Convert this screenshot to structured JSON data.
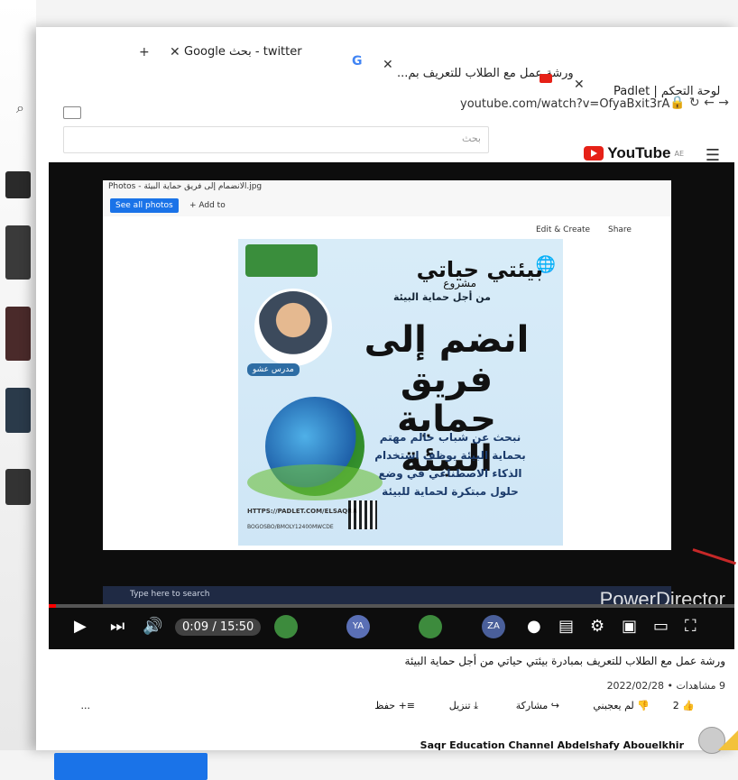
{
  "tabs": [
    {
      "label": "لوحة التحكم | Padlet",
      "icon": "padlet-icon"
    },
    {
      "label": "ورشة عمل مع الطلاب للتعريف بم...",
      "icon": "youtube-icon"
    },
    {
      "label": "twitter - بحث Google",
      "icon": "google-icon"
    }
  ],
  "new_tab_symbol": "+",
  "address": {
    "url": "youtube.com/watch?v=OfyaBxit3rA"
  },
  "search": {
    "placeholder": "بحث"
  },
  "youtube": {
    "brand": "YouTube",
    "region": "AE"
  },
  "photos_app": {
    "title": "Photos - الانضمام إلى فريق حماية البيئة.jpg",
    "see_all": "See all photos",
    "add_to": "+ Add to",
    "edit_create": "Edit & Create",
    "share": "Share"
  },
  "poster": {
    "brand_title": "بيئتي حياتي",
    "project_word": "مشروع",
    "subtitle": "من أجل حماية البيئة",
    "headline": "انضم إلى فريق حماية البيئة",
    "body": "نبحث عن شباب حالم مهتم بحماية البيئة يوظف استخدام الذكاء الاصطناعي في وضع حلول مبتكرة لحماية للبيئة",
    "url_line1": "HTTPS://PADLET.COM/ELSAQRA",
    "url_line2": "BOGOSBO/BMOLY12400MWCDE",
    "teacher_label": "مدرس عشو"
  },
  "taskbar": {
    "search_placeholder": "Type here to search"
  },
  "watermark": "PowerDirector",
  "player": {
    "time": "0:09 / 15:50",
    "progress": 0.01
  },
  "participants": [
    {
      "initials": "",
      "color": "#3d8b3d"
    },
    {
      "initials": "YA",
      "color": "#5a6fb5"
    },
    {
      "initials": "",
      "color": "#3d8b3d"
    },
    {
      "initials": "ZA",
      "color": "#4a5f9a"
    }
  ],
  "video": {
    "title": "ورشة عمل مع الطلاب للتعريف بمبادرة بيئتي حياتي من أجل حماية البيئة",
    "views": "9 مشاهدات",
    "date": "2022/02/28",
    "likes": "2",
    "dislike_label": "لم يعجبني",
    "share_label": "مشاركة",
    "download_label": "تنزيل",
    "save_label": "حفظ",
    "more": "..."
  },
  "channel": {
    "name": "Saqr Education Channel Abdelshafy Abouelkhir"
  },
  "colors": {
    "accent": "#1a73e8",
    "youtube_red": "#e62117"
  }
}
